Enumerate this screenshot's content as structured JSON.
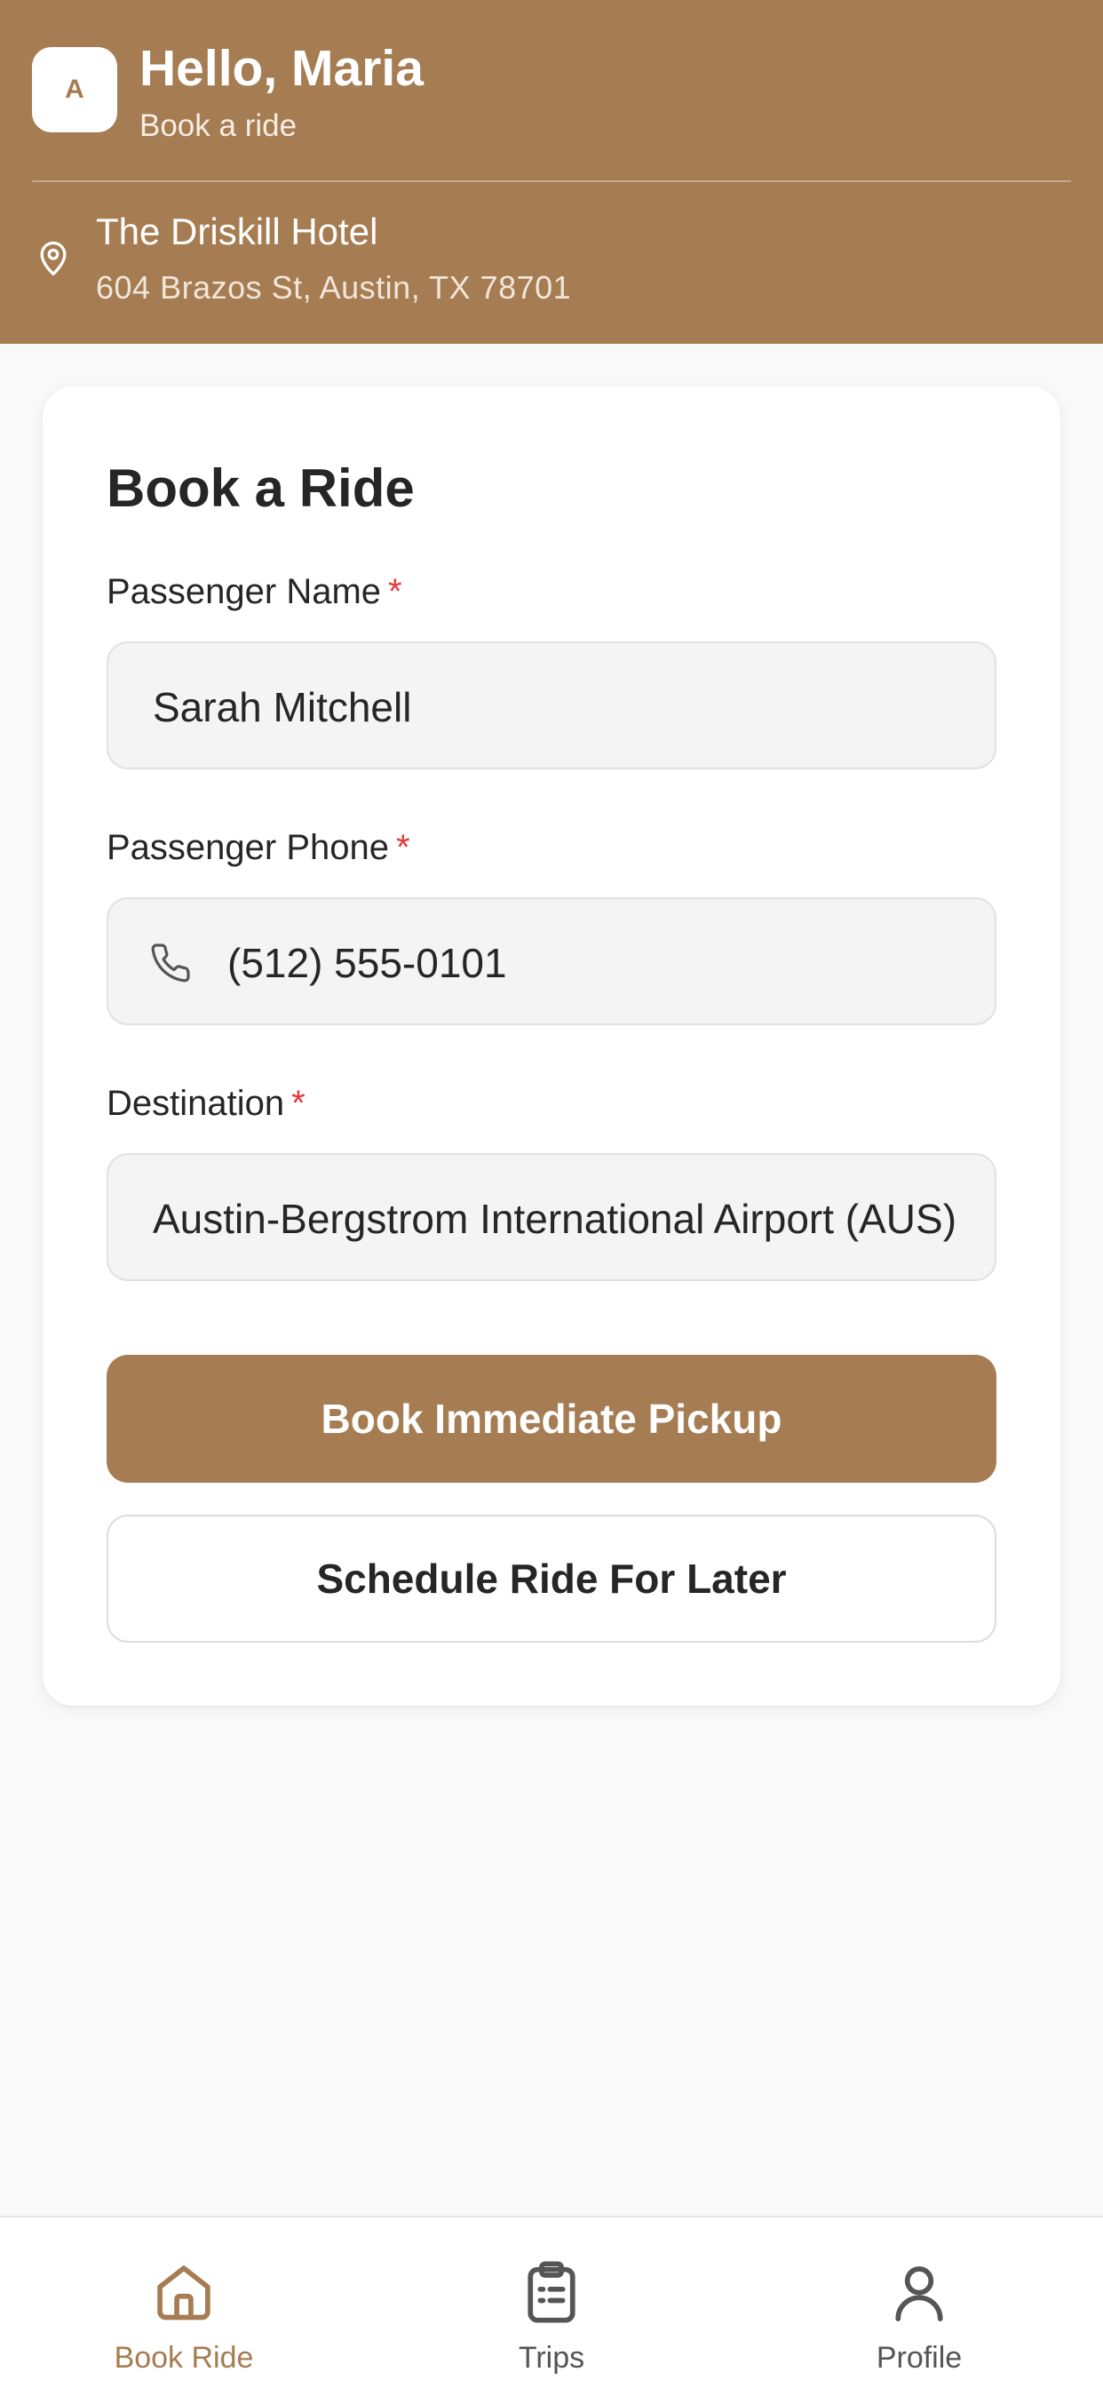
{
  "header": {
    "avatar_letter": "A",
    "greeting": "Hello, Maria",
    "subtitle": "Book a ride",
    "location_name": "The Driskill Hotel",
    "location_address": "604 Brazos St, Austin, TX 78701",
    "location_icon": "map-pin-icon",
    "background_color": "#a67c52"
  },
  "form": {
    "title": "Book a Ride",
    "required_marker": "*",
    "passenger_name": {
      "label": "Passenger Name",
      "value": "Sarah Mitchell"
    },
    "passenger_phone": {
      "label": "Passenger Phone",
      "value": "(512) 555-0101",
      "icon": "phone-icon"
    },
    "destination": {
      "label": "Destination",
      "value": "Austin-Bergstrom International Airport (AUS)"
    },
    "primary_button": "Book Immediate Pickup",
    "secondary_button": "Schedule Ride For Later"
  },
  "nav": {
    "items": [
      {
        "label": "Book Ride",
        "icon": "home-icon",
        "active": true
      },
      {
        "label": "Trips",
        "icon": "clipboard-icon",
        "active": false
      },
      {
        "label": "Profile",
        "icon": "user-icon",
        "active": false
      }
    ]
  },
  "colors": {
    "accent": "#a67c52",
    "required": "#e53935",
    "page_background": "#f9f9f9"
  }
}
